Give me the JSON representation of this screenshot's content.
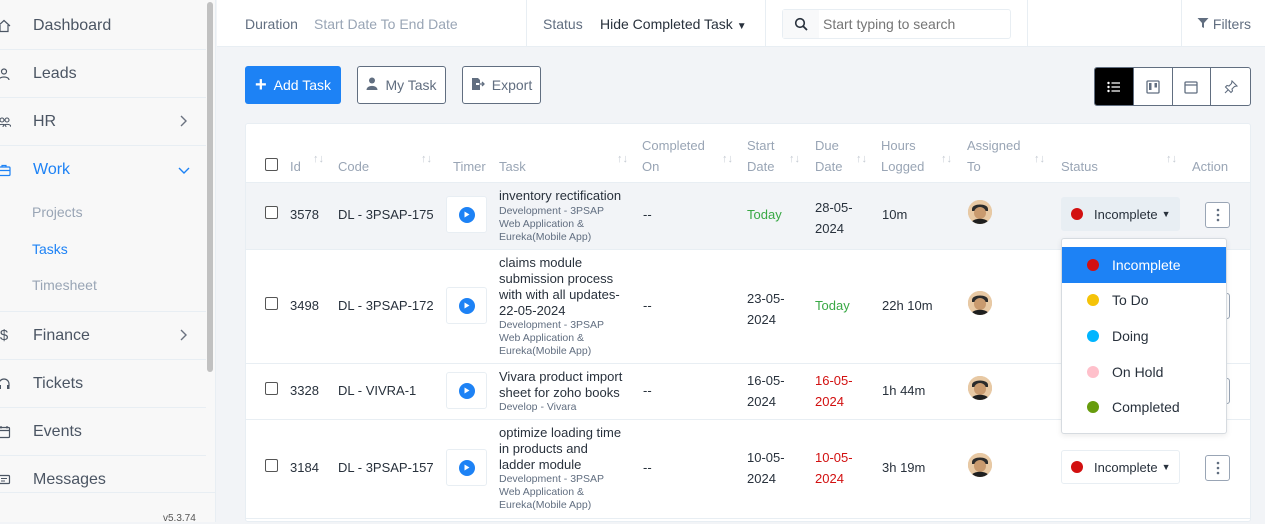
{
  "sidebar": {
    "items": [
      {
        "label": "Dashboard",
        "icon": "home-icon"
      },
      {
        "label": "Leads",
        "icon": "user-icon"
      },
      {
        "label": "HR",
        "icon": "users-icon"
      },
      {
        "label": "Work",
        "icon": "briefcase-icon"
      },
      {
        "label": "Finance",
        "icon": "dollar-icon"
      },
      {
        "label": "Tickets",
        "icon": "headset-icon"
      },
      {
        "label": "Events",
        "icon": "calendar-icon"
      },
      {
        "label": "Messages",
        "icon": "message-icon"
      }
    ],
    "sub_items": [
      "Projects",
      "Tasks",
      "Timesheet"
    ],
    "version": "v5.3.74"
  },
  "filters": {
    "duration_label": "Duration",
    "duration_value": "Start Date To End Date",
    "status_label": "Status",
    "status_value": "Hide Completed Task",
    "search_placeholder": "Start typing to search",
    "filters_label": "Filters"
  },
  "toolbar": {
    "add_task": "Add Task",
    "my_task": "My Task",
    "export": "Export"
  },
  "table": {
    "headers": {
      "id": "Id",
      "code": "Code",
      "timer": "Timer",
      "task": "Task",
      "completed_on_1": "Completed",
      "completed_on_2": "On",
      "start_date_1": "Start",
      "start_date_2": "Date",
      "due_date_1": "Due",
      "due_date_2": "Date",
      "hours_logged_1": "Hours",
      "hours_logged_2": "Logged",
      "assigned_to_1": "Assigned",
      "assigned_to_2": "To",
      "status": "Status",
      "action": "Action"
    },
    "rows": [
      {
        "id": "3578",
        "code": "DL - 3PSAP-175",
        "title": [
          "inventory rectification"
        ],
        "project": [
          "Development - 3PSAP",
          "Web Application &",
          "Eureka(Mobile App)"
        ],
        "completed_on": "--",
        "start_date": [
          "Today"
        ],
        "due_date": [
          "28-05-",
          "2024"
        ],
        "hours": "10m",
        "status": "Incomplete"
      },
      {
        "id": "3498",
        "code": "DL - 3PSAP-172",
        "title": [
          "claims module",
          "submission process",
          "with with all updates-",
          "22-05-2024"
        ],
        "project": [
          "Development - 3PSAP",
          "Web Application &",
          "Eureka(Mobile App)"
        ],
        "completed_on": "--",
        "start_date": [
          "23-05-",
          "2024"
        ],
        "due_date": [
          "Today"
        ],
        "hours": "22h 10m",
        "status": ""
      },
      {
        "id": "3328",
        "code": "DL - VIVRA-1",
        "title": [
          "Vivara product import",
          "sheet for zoho books"
        ],
        "project": [
          "Develop - Vivara"
        ],
        "completed_on": "--",
        "start_date": [
          "16-05-",
          "2024"
        ],
        "due_date": [
          "16-05-",
          "2024"
        ],
        "hours": "1h 44m",
        "status": ""
      },
      {
        "id": "3184",
        "code": "DL - 3PSAP-157",
        "title": [
          "optimize loading time",
          "in products and",
          "ladder module"
        ],
        "project": [
          "Development - 3PSAP",
          "Web Application &",
          "Eureka(Mobile App)"
        ],
        "completed_on": "--",
        "start_date": [
          "10-05-",
          "2024"
        ],
        "due_date": [
          "10-05-",
          "2024"
        ],
        "hours": "3h 19m",
        "status": "Incomplete"
      }
    ]
  },
  "status_dropdown": {
    "options": [
      {
        "label": "Incomplete",
        "color": "#d21010"
      },
      {
        "label": "To Do",
        "color": "#f5c308"
      },
      {
        "label": "Doing",
        "color": "#00b5ff"
      },
      {
        "label": "On Hold",
        "color": "#ffc0cb"
      },
      {
        "label": "Completed",
        "color": "#679c0d"
      }
    ]
  },
  "colors": {
    "accent": "#1d82f5",
    "green_today": "#39a845",
    "red_due": "#d21010"
  }
}
